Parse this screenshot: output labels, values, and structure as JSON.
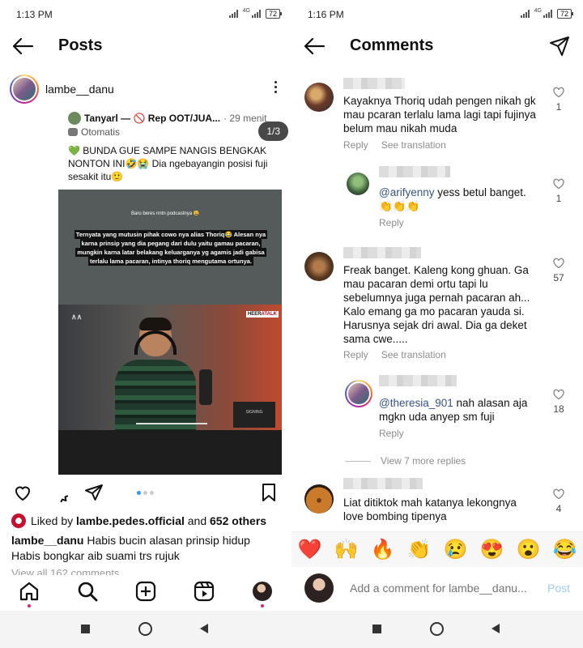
{
  "left": {
    "status": {
      "time": "1:13 PM",
      "network": "4G",
      "battery": "72"
    },
    "header": {
      "title": "Posts"
    },
    "post": {
      "username": "lambe__danu",
      "tweet": {
        "name": "Tanyarl — 🚫 Rep OOT/JUA...",
        "time": "· 29 menit",
        "sub": "Otomatis",
        "text": "💚 BUNDA GUE SAMPE NANGIS BENGKAK NONTON INI🤣😭 Dia ngebayangin posisi fuji sesakit itu🙂"
      },
      "counter": "1/3",
      "video_small": "Baru beres nntn podcastnya 😩",
      "video_caption": "Ternyata yang mutusin pihak cowo nya alias Thoriq😂 Alesan nya karna prinsip yang dia pegang dari dulu yaitu gamau pacaran, mungkin karna latar belakang keluarganya yg agamis jadi gabisa terlalu lama pacaran, intinya thoriq mengutama ortunya.",
      "video_logo": "∧∧",
      "video_tag_a": "HEER",
      "video_tag_b": "ATALK",
      "laptop_text": "SIGNING",
      "carousel": {
        "count": 3,
        "active": 1
      }
    },
    "likes": {
      "prefix": "Liked by",
      "user": "lambe.pedes.official",
      "and": "and",
      "others": "652 others"
    },
    "caption": {
      "user": "lambe__danu",
      "line1": "Habis bucin alasan prinsip hidup",
      "line2": "Habis bongkar aib suami trs rujuk"
    },
    "view_all": "View all 162 comments"
  },
  "right": {
    "status": {
      "time": "1:16 PM",
      "network": "4G",
      "battery": "72"
    },
    "header": {
      "title": "Comments"
    },
    "comments": [
      {
        "text": "Kayaknya Thoriq udah pengen nikah gk mau pcaran terlalu lama lagi tapi fujinya belum mau nikah muda",
        "reply": "Reply",
        "translate": "See translation",
        "likes": "1"
      },
      {
        "mention": "@arifyenny",
        "text": " yess betul banget. 👏👏👏",
        "reply": "Reply",
        "likes": "1"
      },
      {
        "text": "Freak banget. Kaleng kong ghuan. Ga mau pacaran demi ortu tapi lu sebelumnya juga pernah pacaran ah... Kalo emang ga mo pacaran yauda si. Harusnya sejak dri awal. Dia ga deket sama cwe.....",
        "reply": "Reply",
        "translate": "See translation",
        "likes": "57"
      },
      {
        "mention": "@theresia_901",
        "text": " nah alasan aja mgkn uda anyep sm fuji",
        "reply": "Reply",
        "likes": "18"
      },
      {
        "text": "Liat ditiktok mah katanya lekongnya love bombing tipenya",
        "likes": "4"
      }
    ],
    "view_more": "View 7 more replies",
    "emojis": [
      "❤️",
      "🙌",
      "🔥",
      "👏",
      "😢",
      "😍",
      "😮",
      "😂"
    ],
    "input": {
      "placeholder": "Add a comment for lambe__danu...",
      "post": "Post"
    }
  }
}
